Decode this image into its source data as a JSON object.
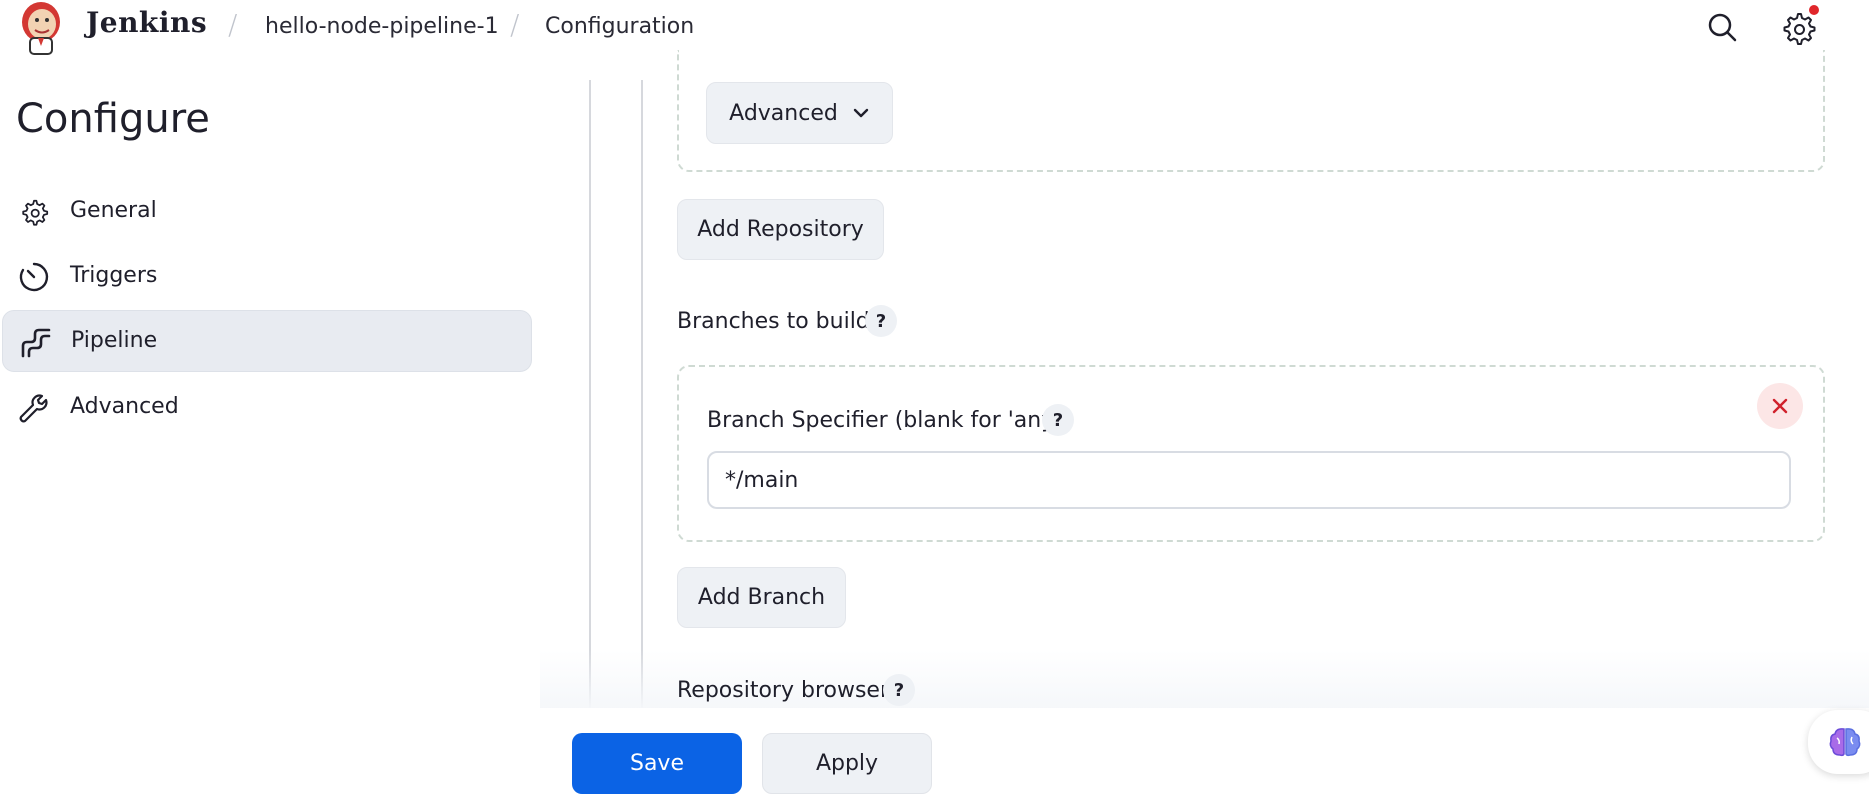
{
  "header": {
    "brand": "Jenkins",
    "breadcrumbs": [
      "hello-node-pipeline-1",
      "Configuration"
    ],
    "separator": "/",
    "icons": [
      "jenkins-logo",
      "search-icon",
      "gear-icon"
    ],
    "notification_color": "#e0262b"
  },
  "sidebar": {
    "title": "Configure",
    "items": [
      {
        "label": "General",
        "icon": "gear-icon",
        "active": false
      },
      {
        "label": "Triggers",
        "icon": "clock-icon",
        "active": false
      },
      {
        "label": "Pipeline",
        "icon": "pipeline-icon",
        "active": true
      },
      {
        "label": "Advanced",
        "icon": "wrench-icon",
        "active": false
      }
    ]
  },
  "main": {
    "advanced_label": "Advanced",
    "add_repository_label": "Add Repository",
    "branches_label": "Branches to build",
    "branch_specifier_label": "Branch Specifier (blank for 'any')",
    "branch_specifier_value": "*/main",
    "add_branch_label": "Add Branch",
    "repository_browser_label": "Repository browser",
    "help_glyph": "?"
  },
  "footer": {
    "save_label": "Save",
    "apply_label": "Apply"
  },
  "colors": {
    "primary": "#0b63e5",
    "active_nav": "#e8ebf1",
    "danger": "#d0212c"
  }
}
